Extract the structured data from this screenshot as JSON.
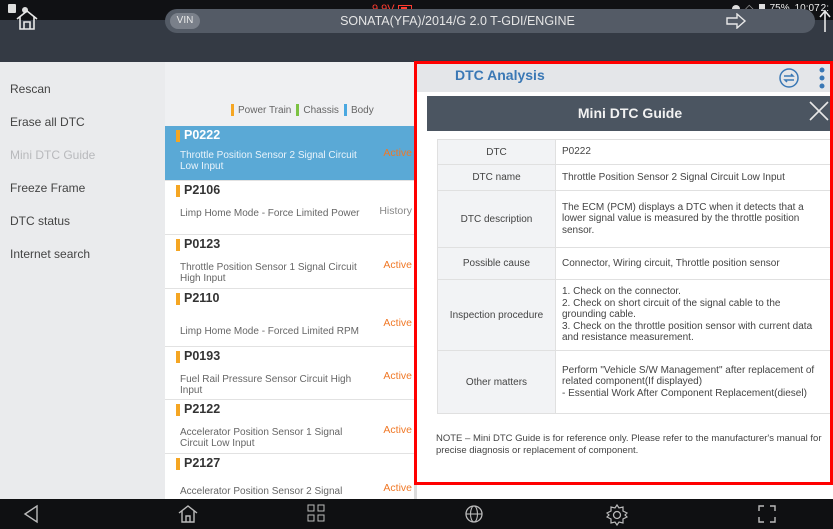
{
  "status_bar": {
    "voltage": "9.9V",
    "battery_percent": "75%",
    "time": "10:07",
    "time_suffix": "2:"
  },
  "title_bar": {
    "vin_label": "VIN",
    "vehicle": "SONATA(YFA)/2014/G 2.0 T-GDI/ENGINE"
  },
  "left_menu": {
    "items": [
      {
        "label": "Rescan",
        "enabled": true
      },
      {
        "label": "Erase all DTC",
        "enabled": true
      },
      {
        "label": "Mini DTC Guide",
        "enabled": false
      },
      {
        "label": "Freeze Frame",
        "enabled": true
      },
      {
        "label": "DTC status",
        "enabled": true
      },
      {
        "label": "Internet search",
        "enabled": true
      }
    ]
  },
  "legend": {
    "items": [
      {
        "label": "Power Train",
        "color": "#f5a623"
      },
      {
        "label": "Chassis",
        "color": "#7cc242"
      },
      {
        "label": "Body",
        "color": "#4aa8e0"
      }
    ]
  },
  "dtc_list": [
    {
      "code": "P0222",
      "desc": "Throttle Position Sensor 2 Signal Circuit Low Input",
      "status": "Active",
      "selected": true
    },
    {
      "code": "P2106",
      "desc": "Limp Home Mode - Force Limited Power",
      "status": "History"
    },
    {
      "code": "P0123",
      "desc": "Throttle Position Sensor 1 Signal Circuit High Input",
      "status": "Active"
    },
    {
      "code": "P2110",
      "desc": "Limp Home Mode - Forced Limited RPM",
      "status": "Active"
    },
    {
      "code": "P0193",
      "desc": "Fuel Rail Pressure Sensor Circuit High Input",
      "status": "Active"
    },
    {
      "code": "P2122",
      "desc": "Accelerator Position Sensor 1 Signal Circuit Low Input",
      "status": "Active"
    },
    {
      "code": "P2127",
      "desc": "Accelerator Position Sensor 2 Signal",
      "status": "Active"
    }
  ],
  "analysis": {
    "title": "DTC Analysis"
  },
  "guide": {
    "title": "Mini DTC Guide",
    "rows": [
      {
        "label": "DTC",
        "value": "P0222"
      },
      {
        "label": "DTC name",
        "value": "Throttle Position Sensor 2 Signal Circuit Low Input"
      },
      {
        "label": "DTC description",
        "value": "The ECM (PCM) displays a DTC when it detects that a lower signal value is measured by the throttle position sensor."
      },
      {
        "label": "Possible cause",
        "value": "Connector, Wiring circuit, Throttle position sensor"
      },
      {
        "label": "Inspection procedure",
        "value": "1. Check on the connector.\n2. Check on short circuit of the signal cable to the grounding cable.\n3. Check on the throttle position sensor with current data and resistance measurement."
      },
      {
        "label": "Other matters",
        "value": "Perform \"Vehicle S/W Management\" after replacement of related component(If displayed)\n- Essential Work After Component Replacement(diesel)"
      }
    ],
    "note": "NOTE – Mini DTC Guide is for reference only. Please refer to the manufacturer's manual for precise diagnosis or replacement of component."
  }
}
